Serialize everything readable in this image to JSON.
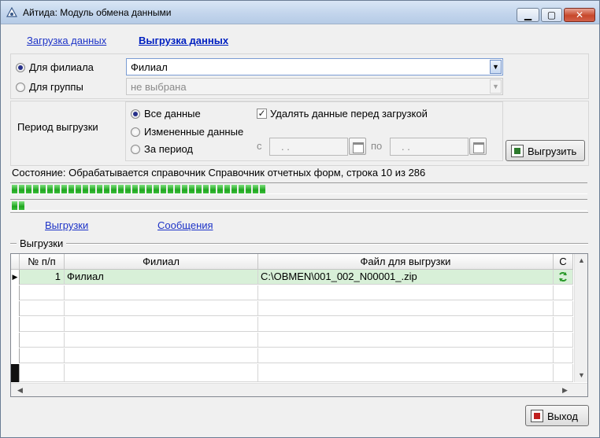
{
  "window": {
    "title": "Айтида: Модуль обмена данными",
    "controls": {
      "minimize": "▁",
      "maximize": "▢",
      "close": "✕"
    }
  },
  "top_tabs": [
    {
      "label": "Загрузка данных"
    },
    {
      "label": "Выгрузка данных"
    }
  ],
  "target": {
    "branch_label": "Для филиала",
    "branch_value": "Филиал",
    "group_label": "Для группы",
    "group_value": "не выбрана"
  },
  "period": {
    "label": "Период выгрузки",
    "options": [
      "Все данные",
      "Измененные данные",
      "За период"
    ],
    "selected": "Все данные",
    "delete_before_load_label": "Удалять данные перед загрузкой",
    "delete_before_load_checked": true,
    "from_label": "с",
    "to_label": "по",
    "from_value": ". .",
    "to_value": ". ."
  },
  "export_button_label": "Выгрузить",
  "status": {
    "text": "Состояние: Обрабатывается справочник Справочник отчетных форм, строка 10 из 286",
    "progress_main_segments": 36,
    "progress_sub_segments": 2,
    "accent": "#22aa22"
  },
  "bottom_tabs": [
    {
      "label": "Выгрузки"
    },
    {
      "label": "Сообщения"
    }
  ],
  "group_title": "Выгрузки",
  "table": {
    "columns": [
      "№ п/п",
      "Филиал",
      "Файл для выгрузки",
      "С"
    ],
    "rows": [
      {
        "num": "1",
        "branch": "Филиал",
        "file": "C:\\OBMEN\\001_002_N00001_.zip",
        "status_icon": "refresh-icon"
      }
    ]
  },
  "exit_button_label": "Выход"
}
